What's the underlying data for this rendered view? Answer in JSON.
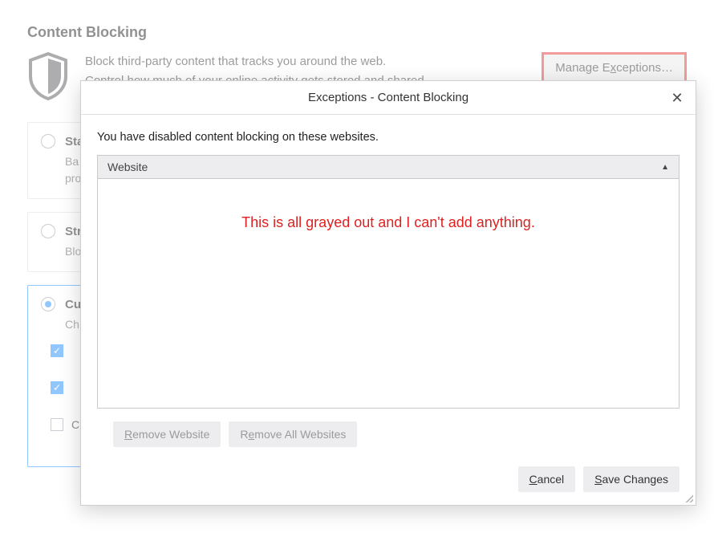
{
  "section_title": "Content Blocking",
  "intro_line1": "Block third-party content that tracks you around the web.",
  "intro_line2": "Control how much of your online activity gets stored and shared",
  "manage_exceptions_prefix": "Manage E",
  "manage_exceptions_underline": "x",
  "manage_exceptions_suffix": "ceptions…",
  "options": {
    "standard": {
      "title": "Standard",
      "desc_prefix": "Ba",
      "desc_line2": "pro"
    },
    "strict": {
      "title": "Strict",
      "desc_prefix": "Blo"
    },
    "custom": {
      "title": "Custom",
      "desc_prefix": "Ch"
    }
  },
  "custom_sub": {
    "item3": "Cryptominers"
  },
  "modal": {
    "title": "Exceptions - Content Blocking",
    "message": "You have disabled content blocking on these websites.",
    "col_website": "Website",
    "remove_one_u": "R",
    "remove_one_rest": "emove Website",
    "remove_all_pre": "R",
    "remove_all_u": "e",
    "remove_all_rest": "move All Websites",
    "cancel_u": "C",
    "cancel_rest": "ancel",
    "save_u": "S",
    "save_rest": "ave Changes"
  },
  "annotation_text": "This is all grayed out and I can't add anything."
}
